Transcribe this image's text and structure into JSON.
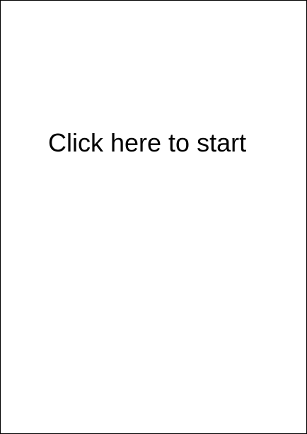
{
  "canvas": {
    "background": "#ffffff",
    "border_color": "#000000"
  },
  "start": {
    "label": "Click here to start",
    "text_color": "#000000"
  }
}
